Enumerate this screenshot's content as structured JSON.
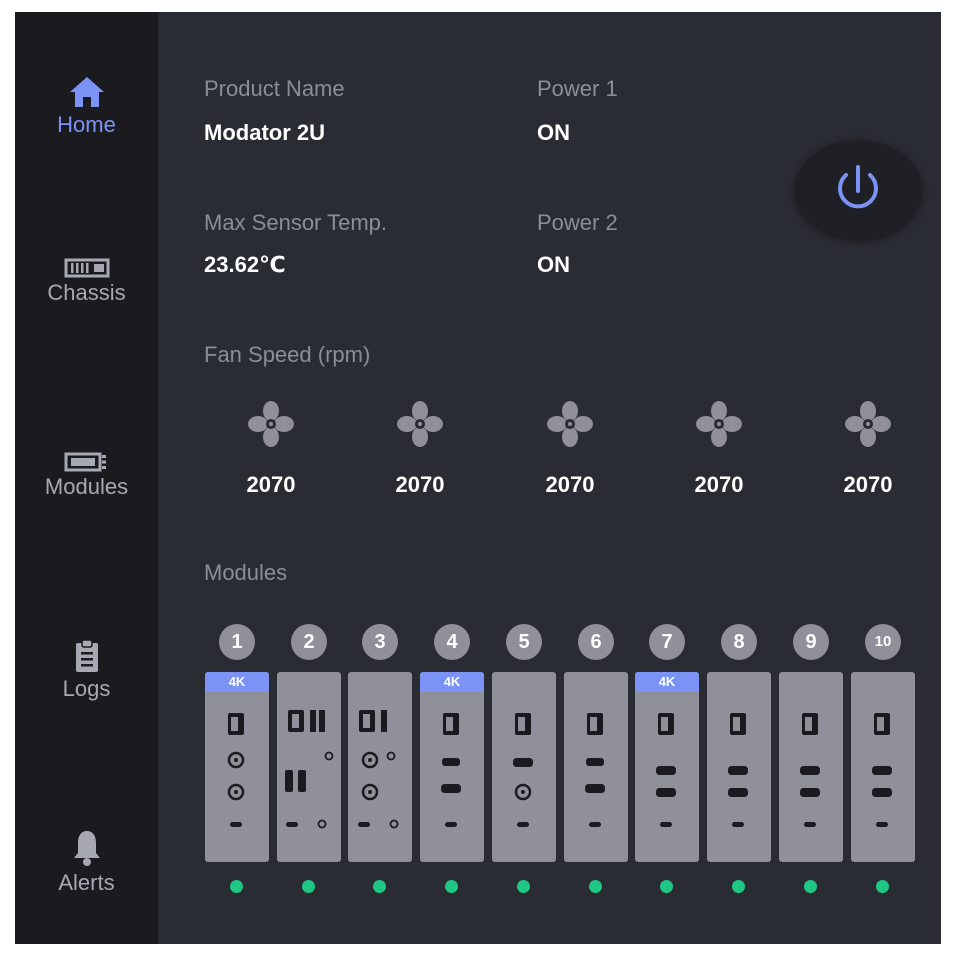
{
  "sidebar": {
    "items": [
      {
        "label": "Home",
        "icon": "home-icon",
        "active": true
      },
      {
        "label": "Chassis",
        "icon": "chassis-icon",
        "active": false
      },
      {
        "label": "Modules",
        "icon": "modules-icon",
        "active": false
      },
      {
        "label": "Logs",
        "icon": "clipboard-icon",
        "active": false
      },
      {
        "label": "Alerts",
        "icon": "bell-icon",
        "active": false
      }
    ]
  },
  "info": {
    "product_name_label": "Product Name",
    "product_name_value": "Modator 2U",
    "power1_label": "Power 1",
    "power1_value": "ON",
    "max_temp_label": "Max Sensor Temp.",
    "max_temp_value": "23.62℃",
    "power2_label": "Power 2",
    "power2_value": "ON"
  },
  "power_button": {
    "icon": "power-icon"
  },
  "fans": {
    "title": "Fan Speed (rpm)",
    "icon": "fan-icon",
    "items": [
      {
        "rpm": "2070"
      },
      {
        "rpm": "2070"
      },
      {
        "rpm": "2070"
      },
      {
        "rpm": "2070"
      },
      {
        "rpm": "2070"
      }
    ]
  },
  "modules": {
    "title": "Modules",
    "items": [
      {
        "number": "1",
        "badge": "4K",
        "status": "ok"
      },
      {
        "number": "2",
        "badge": "",
        "status": "ok"
      },
      {
        "number": "3",
        "badge": "",
        "status": "ok"
      },
      {
        "number": "4",
        "badge": "4K",
        "status": "ok"
      },
      {
        "number": "5",
        "badge": "",
        "status": "ok"
      },
      {
        "number": "6",
        "badge": "",
        "status": "ok"
      },
      {
        "number": "7",
        "badge": "4K",
        "status": "ok"
      },
      {
        "number": "8",
        "badge": "",
        "status": "ok"
      },
      {
        "number": "9",
        "badge": "",
        "status": "ok"
      },
      {
        "number": "10",
        "badge": "",
        "status": "ok"
      }
    ]
  },
  "colors": {
    "accent": "#7b93f4",
    "sidebar_bg": "#1b1b1f",
    "panel_bg": "#2a2c33",
    "status_ok": "#1ec684",
    "module_gray": "#8f9099"
  }
}
